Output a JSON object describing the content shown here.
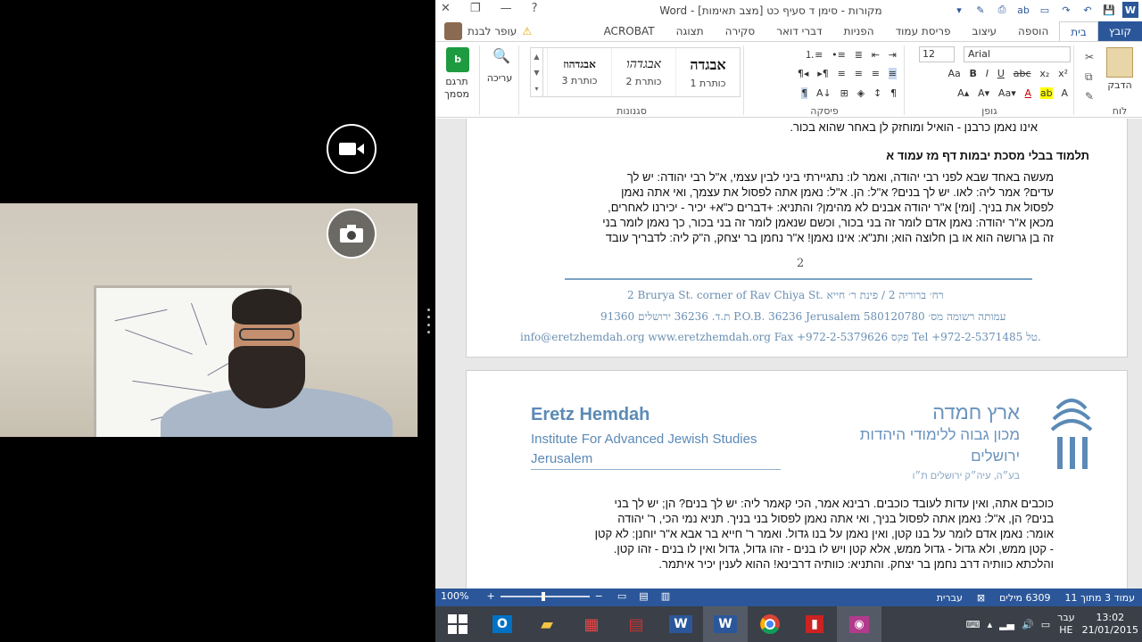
{
  "window": {
    "title": "מקורות - סימן ד סעיף כט [מצב תאימות] - Word",
    "controls": {
      "minimize": "—",
      "restore": "❐",
      "close": "✕"
    }
  },
  "ribbon_tabs": [
    "קובץ",
    "בית",
    "הוספה",
    "עיצוב",
    "פריסת עמוד",
    "הפניות",
    "דברי דואר",
    "סקירה",
    "תצוגה",
    "ACROBAT"
  ],
  "user": {
    "name": "עופר לבנת"
  },
  "ribbon": {
    "clipboard": {
      "label": "לוח",
      "paste": "הדבק"
    },
    "font": {
      "label": "גופן",
      "name": "Arial",
      "size": "12"
    },
    "paragraph": {
      "label": "פיסקה"
    },
    "styles": {
      "label": "סגנונות",
      "items": [
        {
          "preview": "אבגדה",
          "name": "כותרת 1"
        },
        {
          "preview": "אבגדהו",
          "name": "כותרת 2"
        },
        {
          "preview": "אבגדהוז",
          "name": "כותרת 3"
        }
      ]
    },
    "editing": {
      "label": "עריכה"
    },
    "translate": {
      "label": "תרגם מסמך"
    }
  },
  "document": {
    "page1": {
      "top_line": "אינו נאמן כרבנן - הואיל ומוחזק לן באחר שהוא בכור.",
      "heading": "תלמוד בבלי מסכת יבמות דף מז עמוד א",
      "paragraph": [
        "מעשה באחד שבא לפני רבי יהודה, ואמר לו: נתגיירתי ביני לבין עצמי, א\"ל רבי יהודה: יש לך",
        "עדים? אמר ליה: לאו. יש לך בנים? א\"ל: הן. א\"ל: נאמן אתה לפסול את עצמך, ואי אתה נאמן",
        "לפסול את בניך. [ומי] א\"ר יהודה אבנים לא מהימן? והתניא: +דברים כ\"א+ יכיר - יכירנו לאחרים,",
        "מכאן א\"ר יהודה: נאמן אדם לומר זה בני בכור, וכשם שנאמן לומר זה בני בכור, כך נאמן לומר בני",
        "זה בן גרושה הוא או בן חלוצה הוא; ותנ\"א: אינו נאמן! א\"ר נחמן בר יצחק, ה\"ק ליה: לדבריך עובד"
      ],
      "page_number": "2",
      "footer": {
        "line1": "2 Brurya St. corner of Rav Chiya St.  רח׳ ברוריה 2 / פינת ר׳ חייא",
        "line2": "ת.ד. 36236 ירושלים 91360 P.O.B. 36236 Jerusalem  עמותה רשומה מס׳ 580120780",
        "line3": "info@eretzhemdah.org   www.eretzhemdah.org   Fax +972-2-5379626 פקס   Tel +972-2-5371485 טל."
      }
    },
    "page2": {
      "logo_en_title": "Eretz Hemdah",
      "logo_en_sub": "Institute For Advanced Jewish Studies",
      "logo_en_city": "Jerusalem",
      "logo_he_title": "ארץ חמדה",
      "logo_he_sub": "מכון גבוה ללימודי היהדות",
      "logo_he_city": "ירושלים",
      "logo_he_note": "בע״ה, עיה״ק ירושלים ת״ו",
      "paragraph": [
        "כוכבים אתה, ואין עדות לעובד כוכבים. רבינא אמר, הכי קאמר ליה: יש לך בנים? הן; יש לך בני",
        "בנים? הן, א\"ל: נאמן אתה לפסול בניך, ואי אתה נאמן לפסול בני בניך. תניא נמי הכי, ר' יהודה",
        "אומר: נאמן אדם לומר על בנו קטן, ואין נאמן על בנו גדול. ואמר ר' חייא בר אבא א\"ר יוחנן: לא קטן",
        "- קטן ממש, ולא גדול - גדול ממש, אלא קטן ויש לו בנים - זהו גדול, גדול ואין לו בנים - זהו קטן.",
        "והלכתא כוותיה דרב נחמן בר יצחק. והתניא: כוותיה דרבינא! ההוא לענין יכיר איתמר."
      ]
    }
  },
  "statusbar": {
    "page": "עמוד 3 מתוך 11",
    "words": "6309 מילים",
    "language": "עברית",
    "zoom": "100%"
  },
  "taskbar": {
    "clock_time": "13:02",
    "clock_date": "21/01/2015",
    "lang_top": "עבר",
    "lang_bottom": "HE"
  }
}
